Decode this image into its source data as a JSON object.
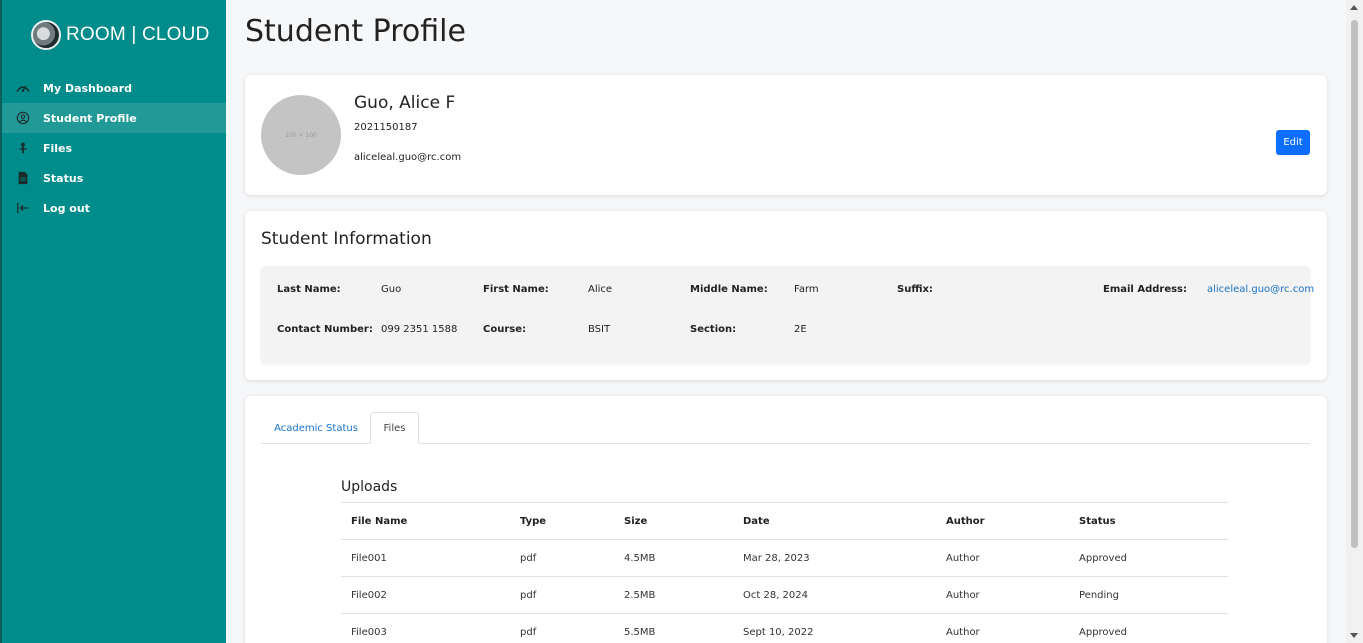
{
  "brand": {
    "name": "ROOM | CLOUD"
  },
  "sidebar": {
    "items": [
      {
        "label": "My Dashboard",
        "icon": "dashboard-icon"
      },
      {
        "label": "Student Profile",
        "icon": "user-circle-icon",
        "active": true
      },
      {
        "label": "Files",
        "icon": "files-icon"
      },
      {
        "label": "Status",
        "icon": "document-icon"
      },
      {
        "label": "Log out",
        "icon": "logout-icon"
      }
    ]
  },
  "page": {
    "title": "Student Profile"
  },
  "profile": {
    "avatar_placeholder": "100 × 100",
    "name": "Guo, Alice F",
    "student_id": "2021150187",
    "email": "aliceleal.guo@rc.com",
    "edit_label": "Edit"
  },
  "info": {
    "title": "Student Information",
    "last_name_label": "Last Name:",
    "last_name": "Guo",
    "first_name_label": "First Name:",
    "first_name": "Alice",
    "middle_name_label": "Middle Name:",
    "middle_name": "Farm",
    "suffix_label": "Suffix:",
    "suffix": "",
    "email_label": "Email Address:",
    "email": "aliceleal.guo@rc.com",
    "contact_label": "Contact Number:",
    "contact": "099 2351 1588",
    "course_label": "Course:",
    "course": "BSIT",
    "section_label": "Section:",
    "section": "2E"
  },
  "tabs": [
    {
      "label": "Academic Status"
    },
    {
      "label": "Files",
      "active": true
    }
  ],
  "uploads": {
    "title": "Uploads",
    "columns": [
      "File Name",
      "Type",
      "Size",
      "Date",
      "Author",
      "Status"
    ],
    "rows": [
      {
        "name": "File001",
        "type": "pdf",
        "size": "4.5MB",
        "date": "Mar 28, 2023",
        "author": "Author",
        "status": "Approved"
      },
      {
        "name": "File002",
        "type": "pdf",
        "size": "2.5MB",
        "date": "Oct 28, 2024",
        "author": "Author",
        "status": "Pending"
      },
      {
        "name": "File003",
        "type": "pdf",
        "size": "5.5MB",
        "date": "Sept 10, 2022",
        "author": "Author",
        "status": "Approved"
      }
    ]
  },
  "colors": {
    "sidebar": "#008c8a",
    "accent": "#0d6efd",
    "approved": "#28a745",
    "pending": "#e0a800"
  }
}
